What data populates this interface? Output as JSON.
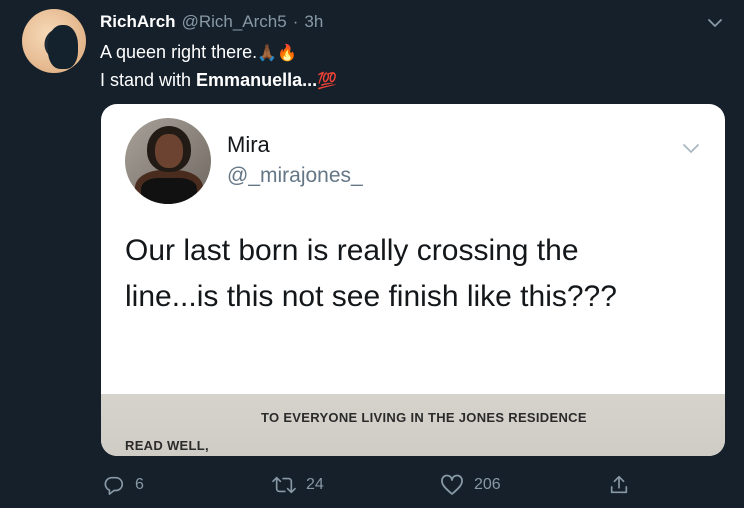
{
  "tweet": {
    "author_name": "RichArch",
    "handle": "@Rich_Arch5",
    "separator": "·",
    "time": "3h",
    "line1_text": "A queen right there.",
    "line1_emojis": "🙏🏾🔥",
    "line2_prefix": "I stand with ",
    "line2_bold": "Emmanuella",
    "line2_suffix": "...",
    "line2_emoji": "💯"
  },
  "quoted": {
    "name": "Mira",
    "handle": "@_mirajones_",
    "text_line1": "Our last born is really crossing the",
    "text_line2": "line...is this not see finish like this???",
    "emoji": "😂",
    "doc_title": "TO EVERYONE LIVING IN THE JONES RESIDENCE",
    "doc_sub": "READ WELL,"
  },
  "actions": {
    "replies": "6",
    "retweets": "24",
    "likes": "206"
  },
  "icons": {
    "caret": "chevron-down-icon",
    "reply": "reply-icon",
    "retweet": "retweet-icon",
    "like": "heart-icon",
    "share": "share-icon"
  },
  "colors": {
    "background": "#15202b",
    "secondary_text": "#8899a6",
    "card": "#ffffff"
  }
}
